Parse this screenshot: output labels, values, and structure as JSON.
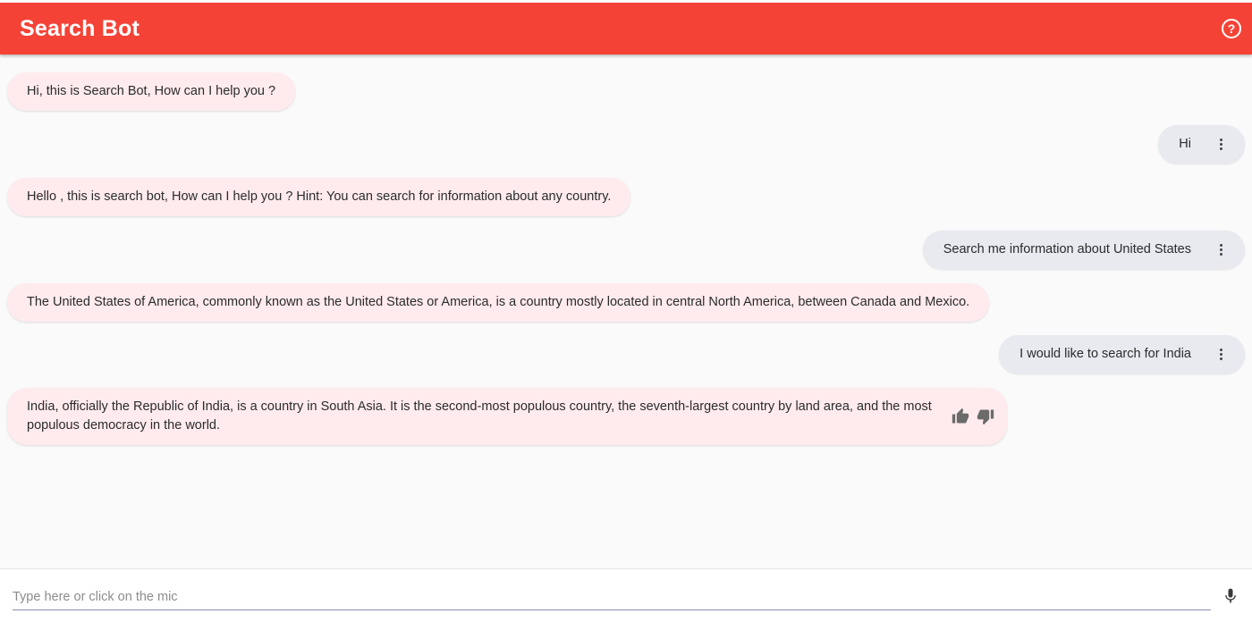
{
  "header": {
    "title": "Search Bot",
    "help_icon": "help-circle-icon",
    "accent": "#f44336"
  },
  "messages": [
    {
      "from": "bot",
      "text": "Hi, this is Search Bot, How can I help you ?"
    },
    {
      "from": "user",
      "text": "Hi"
    },
    {
      "from": "bot",
      "text": "Hello , this is search bot, How can I help you ? Hint: You can search for information about any country."
    },
    {
      "from": "user",
      "text": "Search me information about United States"
    },
    {
      "from": "bot",
      "text": "The United States of America, commonly known as the United States or America, is a country mostly located in central North America, between Canada and Mexico."
    },
    {
      "from": "user",
      "text": "I would like to search for India"
    },
    {
      "from": "bot",
      "text": "India, officially the Republic of India, is a country in South Asia. It is the second-most populous country, the seventh-largest country by land area, and the most populous democracy in the world."
    }
  ],
  "feedback": {
    "up_icon": "thumbs-up-icon",
    "down_icon": "thumbs-down-icon"
  },
  "input": {
    "placeholder": "Type here or click on the mic",
    "value": ""
  },
  "mic_icon": "microphone-icon",
  "colors": {
    "bot_bubble": "#ffebee",
    "user_bubble": "#e8eaf0"
  }
}
